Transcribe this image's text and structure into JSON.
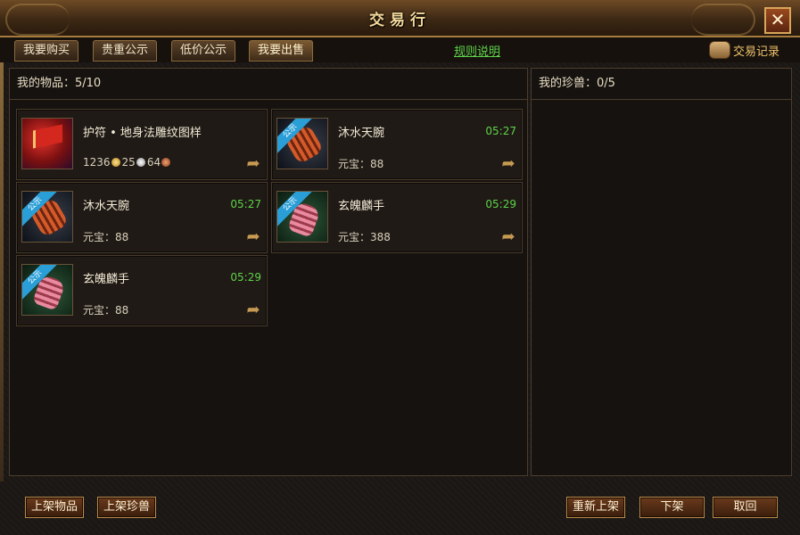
{
  "window": {
    "title": "交易行",
    "close_symbol": "✕"
  },
  "tabs": [
    {
      "label": "我要购买"
    },
    {
      "label": "贵重公示"
    },
    {
      "label": "低价公示"
    },
    {
      "label": "我要出售"
    }
  ],
  "rules_link": "规则说明",
  "trade_record": "交易记录",
  "items_panel": {
    "header": "我的物品：5/10"
  },
  "pets_panel": {
    "header": "我的珍兽：0/5"
  },
  "items": [
    {
      "name": "护符 • 地身法雕纹图样",
      "icon": "amulet-icon",
      "badge": "",
      "timer": "",
      "price_label": "",
      "price_value": "",
      "gold": "1236",
      "silver": "25",
      "copper": "64"
    },
    {
      "name": "沐水天腕",
      "icon": "bracer-icon",
      "badge": "公示",
      "timer": "05:27",
      "price_label": "元宝：",
      "price_value": "88"
    },
    {
      "name": "沐水天腕",
      "icon": "bracer-icon",
      "badge": "公示",
      "timer": "05:27",
      "price_label": "元宝：",
      "price_value": "88"
    },
    {
      "name": "玄魄麟手",
      "icon": "glove-icon",
      "badge": "公示",
      "timer": "05:29",
      "price_label": "元宝：",
      "price_value": "388"
    },
    {
      "name": "玄魄麟手",
      "icon": "glove-icon",
      "badge": "公示",
      "timer": "05:29",
      "price_label": "元宝：",
      "price_value": "88"
    }
  ],
  "buttons": {
    "list_item": "上架物品",
    "list_pet": "上架珍兽",
    "relist": "重新上架",
    "delist": "下架",
    "cancel": "取回"
  },
  "colors": {
    "timer": "#5fd34a",
    "rules": "#5fd34a",
    "badge": "#2a9ed6",
    "record": "#f1c36a"
  }
}
